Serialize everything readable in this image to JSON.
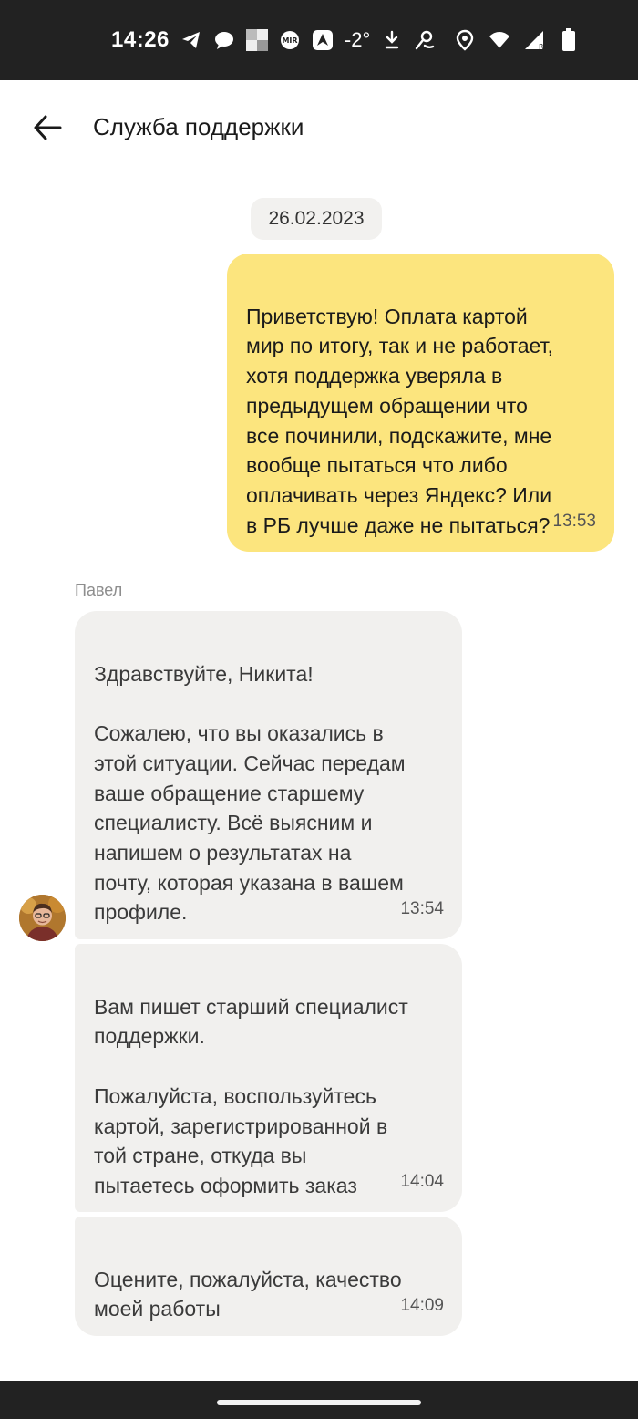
{
  "status_bar": {
    "time": "14:26",
    "temperature": "-2°",
    "icons_left": [
      "telegram-icon",
      "chat-icon",
      "app-tile-icon",
      "mir-pay-icon",
      "navigator-icon",
      "temperature",
      "download-icon",
      "search-person-icon"
    ],
    "icons_right": [
      "location-icon",
      "wifi-icon",
      "signal-icon",
      "battery-icon"
    ]
  },
  "header": {
    "back_icon": "arrow-left-icon",
    "title": "Служба поддержки"
  },
  "chat": {
    "date": "26.02.2023",
    "messages": [
      {
        "direction": "outgoing",
        "text": "Приветствую! Оплата картой\nмир по итогу, так и не работает,\nхотя поддержка уверяла в\nпредыдущем обращении что\nвсе починили, подскажите, мне\nвообще пытаться что либо\nоплачивать через Яндекс? Или\nв РБ лучше даже не пытаться?",
        "time": "13:53"
      },
      {
        "direction": "incoming",
        "sender": "Павел",
        "text": "Здравствуйте, Никита!\n\nСожалею, что вы оказались в\nэтой ситуации. Сейчас передам\nваше обращение старшему\nспециалисту. Всё выясним и\nнапишем о результатах на\nпочту, которая указана в вашем\nпрофиле.",
        "time": "13:54"
      },
      {
        "direction": "incoming",
        "text": "Вам пишет старший специалист\nподдержки.\n\nПожалуйста, воспользуйтесь\nкартой, зарегистрированной в\nтой стране, откуда вы\nпытаетесь оформить заказ",
        "time": "14:04"
      },
      {
        "direction": "incoming",
        "text": "Оцените, пожалуйста, качество\nмоей работы",
        "time": "14:09"
      }
    ]
  },
  "colors": {
    "outgoing_bubble": "#fce57e",
    "incoming_bubble": "#f1f0ee",
    "status_bar": "#222222"
  }
}
